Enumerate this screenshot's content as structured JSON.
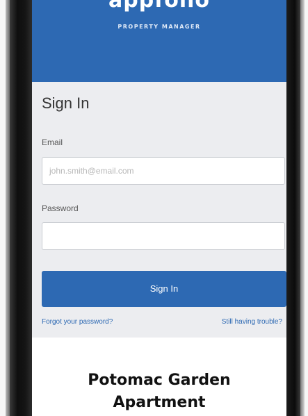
{
  "app": {
    "logo_text": "appfolio",
    "logo_subtitle": "PROPERTY MANAGER"
  },
  "signin": {
    "title": "Sign In",
    "email_label": "Email",
    "email_placeholder": "john.smith@email.com",
    "email_value": "",
    "password_label": "Password",
    "password_value": "",
    "submit_label": "Sign In",
    "forgot_link": "Forgot your password?",
    "trouble_link": "Still having trouble?"
  },
  "property": {
    "name_line1": "Potomac Garden",
    "name_line2": "Apartment"
  },
  "colors": {
    "brand_blue": "#2d69b3",
    "phone_frame": "#111111"
  }
}
